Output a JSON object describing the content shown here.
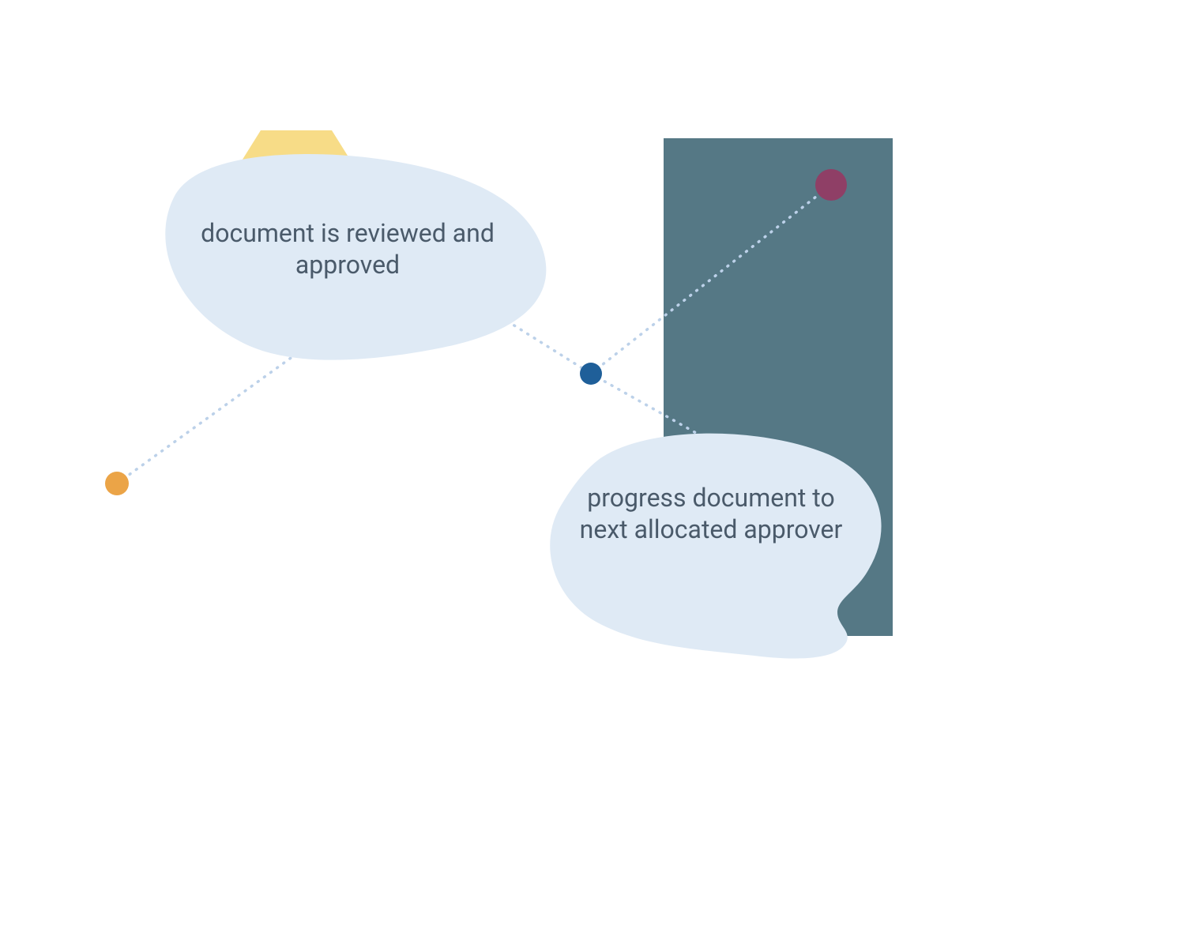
{
  "colors": {
    "background": "#ffffff",
    "blob": "#dfeaf5",
    "panel": "#557885",
    "hexagon": "#f7dc87",
    "text": "#4a5a6a",
    "dot_blue": "#1f5f99",
    "dot_orange": "#eba447",
    "dot_plum": "#8f3f66",
    "connector": "#bcd1e9"
  },
  "nodes": {
    "top_blob": {
      "label": "document is reviewed and approved"
    },
    "bottom_blob": {
      "label": "progress document to next allocated approver"
    }
  }
}
